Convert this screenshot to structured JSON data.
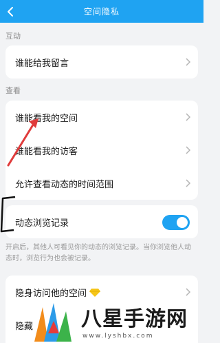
{
  "nav": {
    "title": "空间隐私"
  },
  "sections": {
    "interact": {
      "label": "互动",
      "rows": [
        {
          "label": "谁能给我留言"
        }
      ]
    },
    "view": {
      "label": "查看",
      "rows": [
        {
          "label": "谁能看我的空间"
        },
        {
          "label": "谁能看我的访客"
        },
        {
          "label": "允许查看动态的时间范围"
        }
      ]
    },
    "browse": {
      "label": "动态浏览记录",
      "enabled": true,
      "description": "开启后，其他人可看见你的动态的浏览记录。当你浏览他人动态时，浏览行为也会被记录。"
    },
    "stealth": {
      "rows": [
        {
          "label": "隐身访问他的空间"
        },
        {
          "label": "隐藏"
        }
      ]
    }
  },
  "watermark": {
    "text": "八星手游网",
    "url": "www.lyshbx.com"
  },
  "colors": {
    "accent": "#1fa3f2",
    "annotation": "#e03b3b"
  }
}
